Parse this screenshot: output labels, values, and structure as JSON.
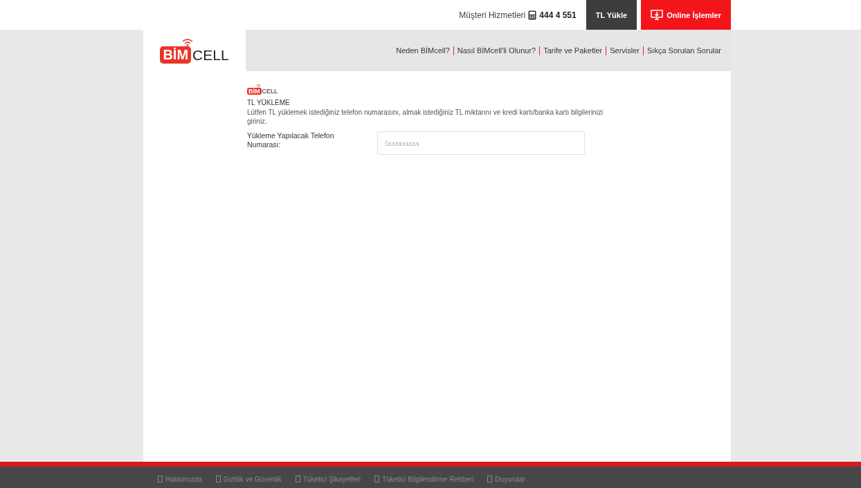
{
  "top_bar": {
    "support_label": "Müşteri Hizmetleri",
    "support_phone": "444 4 551",
    "buttons": [
      {
        "label": "TL Yükle",
        "kind": "dark"
      },
      {
        "label": "Online İşlemler",
        "kind": "red"
      }
    ]
  },
  "header": {
    "logo": {
      "red_part": "BİM",
      "dark_part": "CELL"
    },
    "nav": [
      "Neden BİMcell?",
      "Nasıl BİMcell'li Olunur?",
      "Tarife ve Paketler",
      "Servisler",
      "Sıkça Sorulan Sorular"
    ]
  },
  "content": {
    "logo": {
      "red_part": "BİM",
      "dark_part": "CELL"
    },
    "title": "TL YÜKLEME",
    "description": "Lütfen TL yüklemek istediğiniz telefon numarasını, almak istediğiniz TL miktarını ve kredi kartı/banka kartı bilgilerinizi giriniz.",
    "field": {
      "label": "Yükleme Yapılacak Telefon Numarası:",
      "placeholder": "5xxxxxxxxx"
    }
  },
  "footer": {
    "links": [
      "Hakkımızda",
      "Gizlilik ve Güvenlik",
      "Tüketici Şikayetleri",
      "Tüketici Bilgilendirme Rehberi",
      "Duyurular"
    ]
  }
}
